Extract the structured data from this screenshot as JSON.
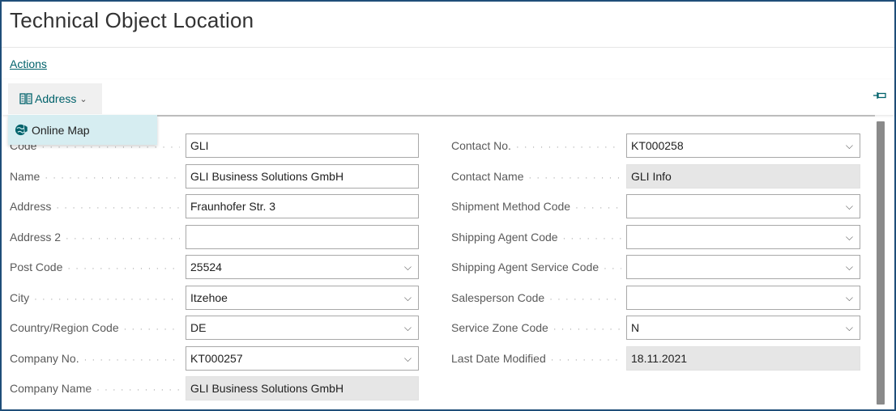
{
  "page": {
    "title": "Technical Object Location"
  },
  "actions_label": "Actions",
  "toolbar": {
    "address_label": "Address",
    "menu_item": "Online Map"
  },
  "left_fields": [
    {
      "label": "Code",
      "value": "GLI",
      "dropdown": false,
      "readonly": false
    },
    {
      "label": "Name",
      "value": "GLI Business Solutions GmbH",
      "dropdown": false,
      "readonly": false
    },
    {
      "label": "Address",
      "value": "Fraunhofer Str. 3",
      "dropdown": false,
      "readonly": false
    },
    {
      "label": "Address 2",
      "value": "",
      "dropdown": false,
      "readonly": false
    },
    {
      "label": "Post Code",
      "value": "25524",
      "dropdown": true,
      "readonly": false
    },
    {
      "label": "City",
      "value": "Itzehoe",
      "dropdown": true,
      "readonly": false
    },
    {
      "label": "Country/Region Code",
      "value": "DE",
      "dropdown": true,
      "readonly": false
    },
    {
      "label": "Company No.",
      "value": "KT000257",
      "dropdown": true,
      "readonly": false
    },
    {
      "label": "Company Name",
      "value": "GLI Business Solutions GmbH",
      "dropdown": false,
      "readonly": true
    }
  ],
  "right_fields": [
    {
      "label": "Contact No.",
      "value": "KT000258",
      "dropdown": true,
      "readonly": false
    },
    {
      "label": "Contact Name",
      "value": "GLI Info",
      "dropdown": false,
      "readonly": true
    },
    {
      "label": "Shipment Method Code",
      "value": "",
      "dropdown": true,
      "readonly": false
    },
    {
      "label": "Shipping Agent Code",
      "value": "",
      "dropdown": true,
      "readonly": false
    },
    {
      "label": "Shipping Agent Service Code",
      "value": "",
      "dropdown": true,
      "readonly": false
    },
    {
      "label": "Salesperson Code",
      "value": "",
      "dropdown": true,
      "readonly": false
    },
    {
      "label": "Service Zone Code",
      "value": "N",
      "dropdown": true,
      "readonly": false
    },
    {
      "label": "Last Date Modified",
      "value": "18.11.2021",
      "dropdown": false,
      "readonly": true
    }
  ],
  "colors": {
    "accent": "#00626b",
    "menu_bg": "#d6edf1",
    "frame": "#1f4e79"
  },
  "icons": {
    "address": "address-book-icon",
    "menu": "globe-icon",
    "pin": "pin-icon",
    "dropdown": "chevron-down-icon"
  }
}
